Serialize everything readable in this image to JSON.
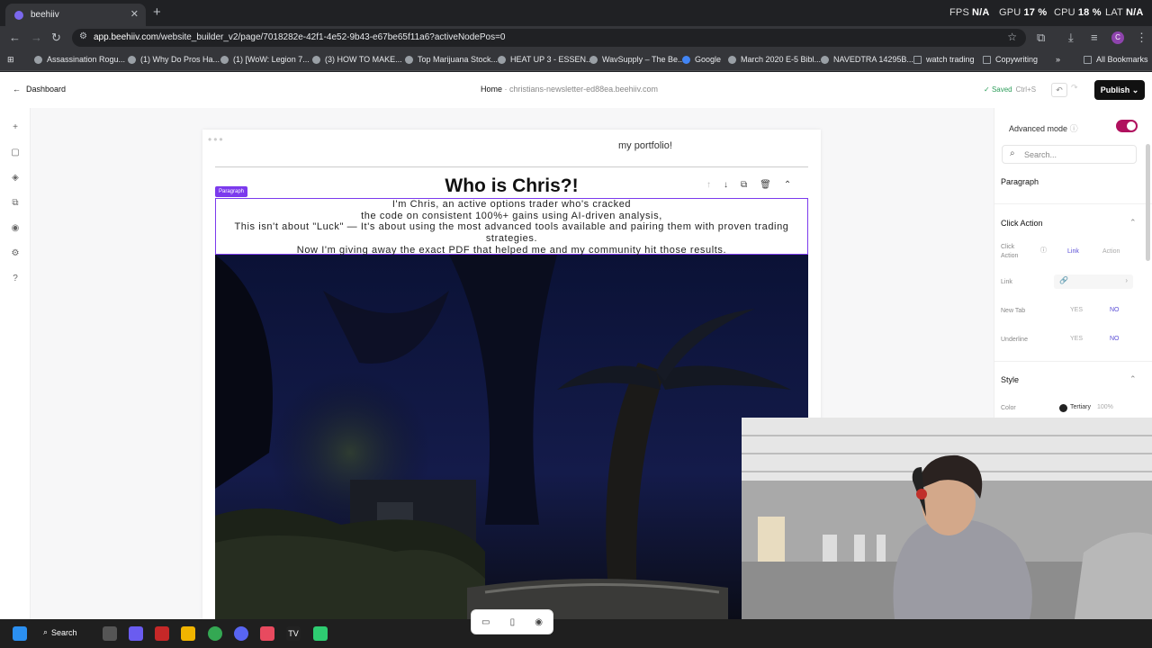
{
  "browser": {
    "tab_title": "beehiiv",
    "url_host": "app.beehiiv.com",
    "url_path": "/website_builder_v2/page/7018282e-42f1-4e52-9b43-e67be65f11a6?activeNodePos=0",
    "perf": {
      "fps_label": "FPS",
      "fps_value": "N/A",
      "gpu_label": "GPU",
      "gpu_value": "17 %",
      "cpu_label": "CPU",
      "cpu_value": "18 %",
      "lat_label": "LAT",
      "lat_value": "N/A"
    },
    "bookmarks": [
      "Assassination Rogu...",
      "(1) Why Do Pros Ha...",
      "(1) [WoW: Legion 7...",
      "(3) HOW TO MAKE...",
      "Top Marijuana Stock...",
      "HEAT UP 3 - ESSEN...",
      "WavSupply – The Be...",
      "Google",
      "March 2020 E-5 Bibl...",
      "NAVEDTRA 14295B...",
      "watch trading",
      "Copywriting"
    ],
    "all_bookmarks": "All Bookmarks",
    "profile_initial": "C"
  },
  "header": {
    "back_label": "Dashboard",
    "crumb_home": "Home",
    "crumb_sep": "·",
    "crumb_site": "christians-newsletter-ed88ea.beehiiv.com",
    "saved_label": "Saved",
    "saved_shortcut": "Ctrl+S",
    "publish_label": "Publish"
  },
  "canvas": {
    "portfolio_text": "my portfolio!",
    "heading": "Who is Chris?!",
    "selected_tag": "Paragraph",
    "paragraph_lines": [
      "I'm Chris, an active options trader who's cracked",
      "the code on consistent 100%+ gains using AI-driven analysis,",
      "This isn't about \"Luck\" — It's about using the most advanced tools available and pairing them with proven trading",
      "strategies.",
      "Now I'm giving away the exact PDF that helped me and my community hit those results."
    ]
  },
  "panel": {
    "advanced_mode": "Advanced mode",
    "search_placeholder": "Search...",
    "element_type": "Paragraph",
    "click_action_section": "Click Action",
    "click_action_label": "Click Action",
    "link_tab": "Link",
    "action_tab": "Action",
    "link_label": "Link",
    "new_tab_label": "New Tab",
    "underline_label": "Underline",
    "yes": "YES",
    "no": "NO",
    "style_section": "Style",
    "color_label": "Color",
    "color_value": "Tertiary",
    "color_opacity": "100%"
  },
  "taskbar": {
    "search_label": "Search"
  },
  "colors": {
    "accent_purple": "#7c3aed",
    "toggle_on": "#b0105e",
    "saved_green": "#2e9e5b"
  }
}
